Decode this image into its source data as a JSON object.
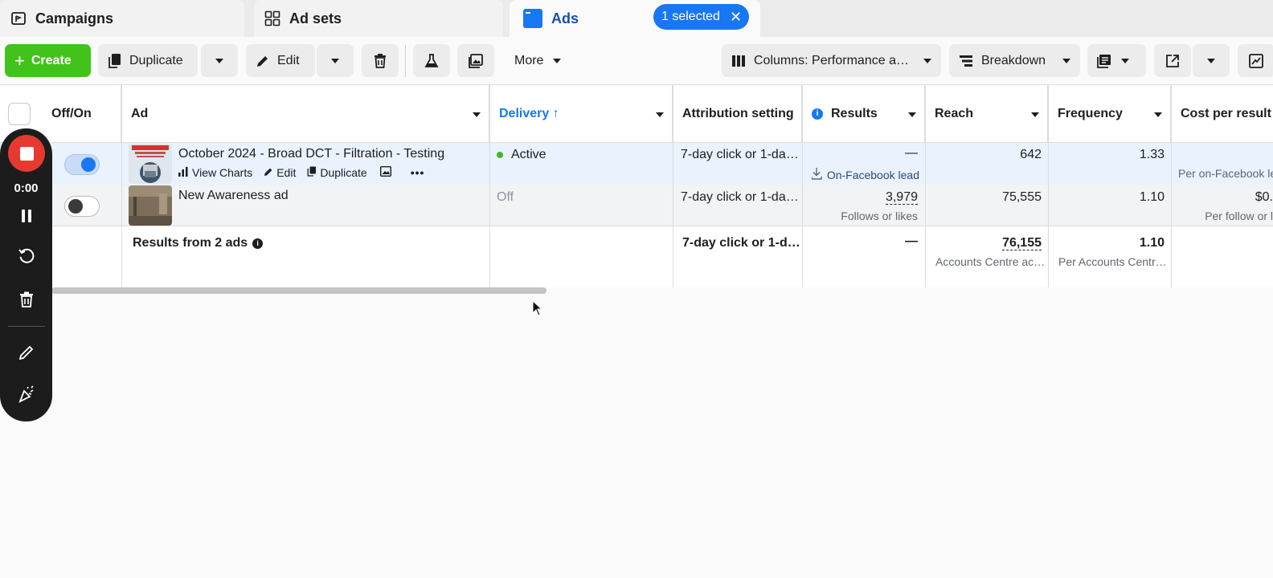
{
  "tabs": {
    "campaigns": "Campaigns",
    "ad_sets": "Ad sets",
    "ads": "Ads",
    "selected_label": "1 selected"
  },
  "toolbar": {
    "create": "Create",
    "duplicate": "Duplicate",
    "edit": "Edit",
    "more": "More",
    "columns": "Columns: Performance a…",
    "breakdown": "Breakdown"
  },
  "table": {
    "headers": {
      "off_on": "Off/On",
      "ad": "Ad",
      "delivery": "Delivery ↑",
      "attribution": "Attribution setting",
      "results": "Results",
      "reach": "Reach",
      "frequency": "Frequency",
      "cost_per_result": "Cost per result"
    },
    "rows": [
      {
        "toggle": "on",
        "ad_name": "October 2024 - Broad DCT - Filtration - Testing",
        "actions": [
          "View Charts",
          "Edit",
          "Duplicate"
        ],
        "delivery": "Active",
        "attribution": "7-day click or 1-da…",
        "results": "—",
        "results_sub": "On-Facebook lead",
        "reach": "642",
        "frequency": "1.33",
        "cost_per_result": "",
        "cost_sub": "Per on-Facebook le"
      },
      {
        "toggle": "off",
        "ad_name": "New Awareness ad",
        "delivery": "Off",
        "attribution": "7-day click or 1-da…",
        "results": "3,979",
        "results_sub": "Follows or likes",
        "reach": "75,555",
        "frequency": "1.10",
        "cost_per_result": "$0.",
        "cost_sub": "Per follow or l"
      }
    ],
    "summary": {
      "label": "Results from 2 ads",
      "attribution": "7-day click or 1-d…",
      "results": "—",
      "reach": "76,155",
      "reach_sub": "Accounts Centre ac…",
      "frequency": "1.10",
      "frequency_sub": "Per Accounts Centr…"
    }
  },
  "recorder": {
    "time": "0:00"
  },
  "colors": {
    "accent": "#1877f2",
    "create_green": "#42c31b",
    "active_dot": "#42b72a",
    "record_red": "#e63a30"
  }
}
